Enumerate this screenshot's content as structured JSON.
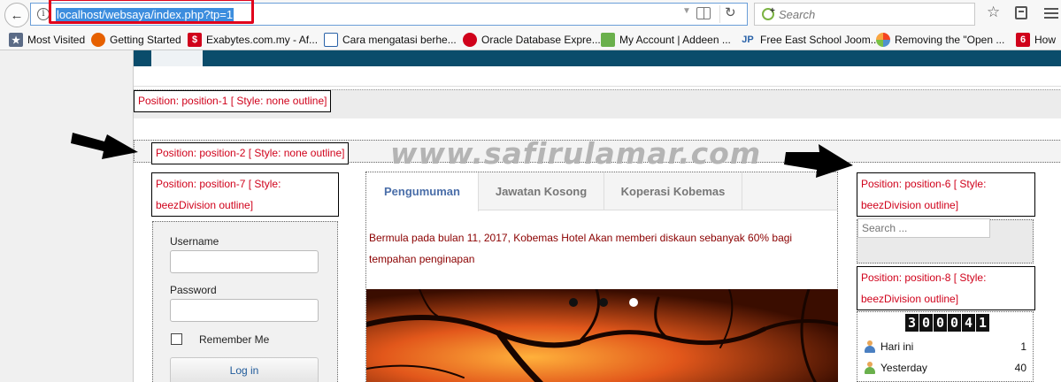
{
  "browser": {
    "url": "localhost/websaya/index.php?tp=1",
    "search_placeholder": "Search"
  },
  "bookmarks": [
    {
      "label": "Most Visited",
      "icon": "bookmark-star-icon"
    },
    {
      "label": "Getting Started",
      "icon": "firefox-icon"
    },
    {
      "label": "Exabytes.com.my - Af...",
      "icon": "exabytes-icon"
    },
    {
      "label": "Cara mengatasi berhe...",
      "icon": "page-icon"
    },
    {
      "label": "Oracle Database Expre...",
      "icon": "oracle-icon"
    },
    {
      "label": "My Account | Addeen ...",
      "icon": "addeen-icon"
    },
    {
      "label": "Free East School Joom...",
      "icon": "jp-icon"
    },
    {
      "label": "Removing the \"Open ...",
      "icon": "joomla-icon"
    },
    {
      "label": "How",
      "icon": "six-icon"
    }
  ],
  "positions": {
    "p1": "Position: position-1 [ Style: none outline]",
    "p2": "Position: position-2 [ Style: none outline]",
    "p7": "Position: position-7 [ Style: beezDivision outline]",
    "p6": "Position: position-6 [ Style: beezDivision outline]",
    "p8": "Position: position-8 [ Style: beezDivision outline]"
  },
  "watermark": "www.safirulamar.com",
  "login": {
    "username_label": "Username",
    "password_label": "Password",
    "remember_label": "Remember Me",
    "button_label": "Log in"
  },
  "tabs": [
    "Pengumuman",
    "Jawatan Kosong",
    "Koperasi Kobemas"
  ],
  "announcement": "Bermula pada bulan 11, 2017, Kobemas Hotel Akan memberi diskaun sebanyak 60% bagi tempahan penginapan",
  "search_placeholder": "Search ...",
  "counter": [
    "3",
    "0",
    "0",
    "0",
    "4",
    "1"
  ],
  "stats": [
    {
      "label": "Hari ini",
      "value": "1"
    },
    {
      "label": "Yesterday",
      "value": "40"
    }
  ],
  "colors": {
    "accent_red": "#d0021b",
    "header_blue": "#0a4c6b",
    "tab_active": "#4a6ea9"
  }
}
